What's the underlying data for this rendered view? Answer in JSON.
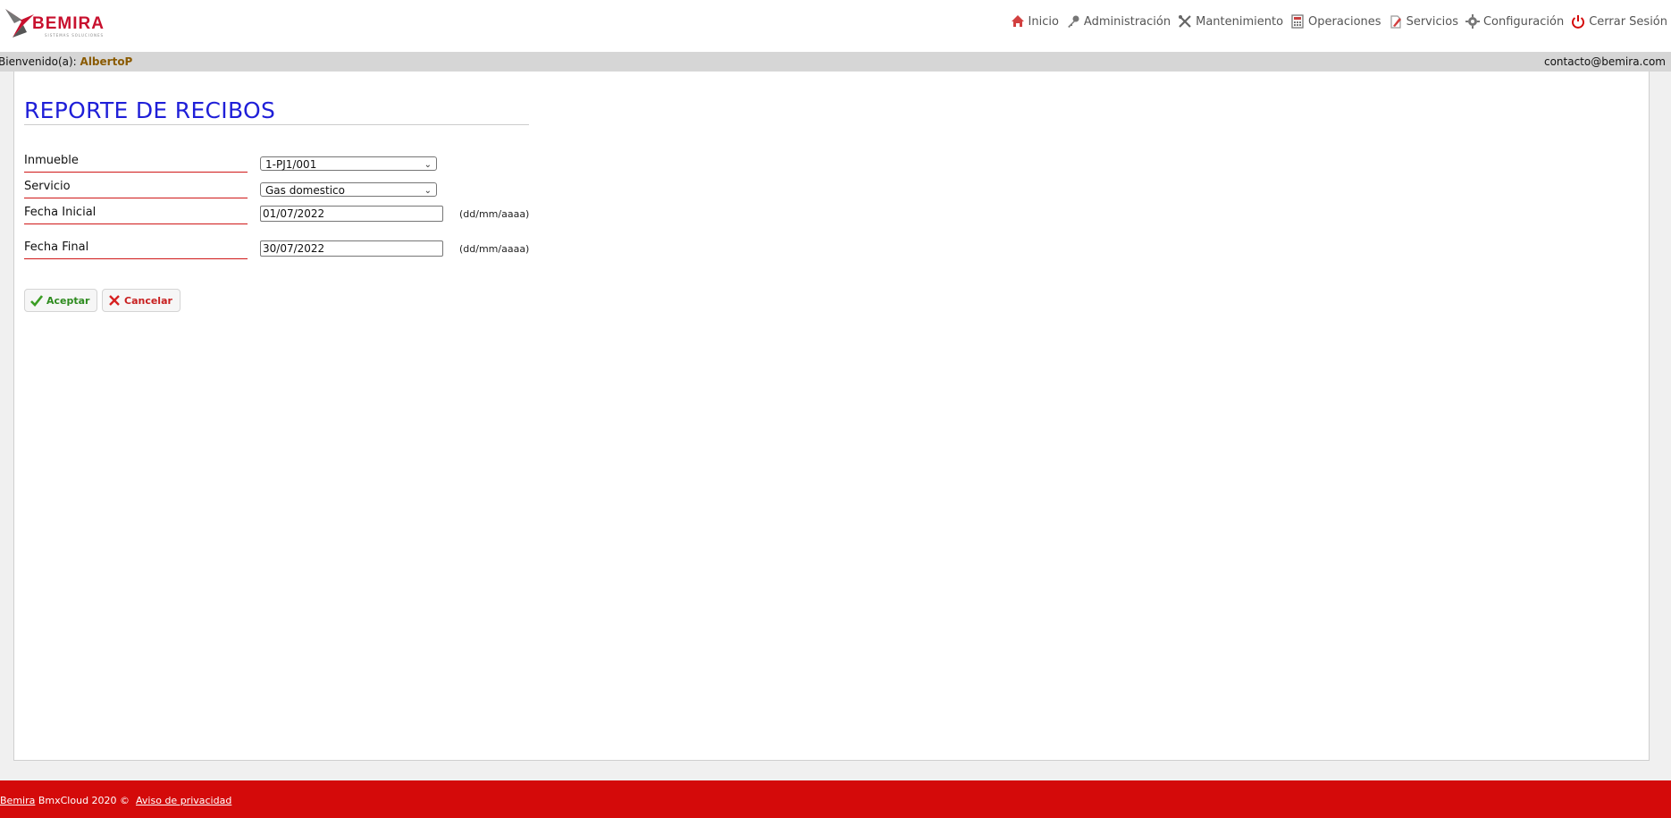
{
  "brand": {
    "name": "BEMIRA",
    "tagline": "SISTEMAS SOLUCIONES",
    "color": "#c8102e"
  },
  "nav": [
    {
      "label": "Inicio",
      "icon": "home-icon"
    },
    {
      "label": "Administración",
      "icon": "key-icon"
    },
    {
      "label": "Mantenimiento",
      "icon": "tools-icon"
    },
    {
      "label": "Operaciones",
      "icon": "calculator-icon"
    },
    {
      "label": "Servicios",
      "icon": "edit-document-icon"
    },
    {
      "label": "Configuración",
      "icon": "gear-icon"
    },
    {
      "label": "Cerrar Sesión",
      "icon": "power-icon"
    }
  ],
  "welcome": {
    "prefix": "Bienvenido(a):",
    "user": "AlbertoP",
    "contact": "contacto@bemira.com"
  },
  "page": {
    "title": "REPORTE DE RECIBOS"
  },
  "form": {
    "inmueble": {
      "label": "Inmueble",
      "value": "1-PJ1/001"
    },
    "servicio": {
      "label": "Servicio",
      "value": "Gas domestico"
    },
    "fecha_inicial": {
      "label": "Fecha Inicial",
      "value": "01/07/2022",
      "hint": "(dd/mm/aaaa)"
    },
    "fecha_final": {
      "label": "Fecha Final",
      "value": "30/07/2022",
      "hint": "(dd/mm/aaaa)"
    }
  },
  "buttons": {
    "accept": "Aceptar",
    "cancel": "Cancelar"
  },
  "footer": {
    "brand_link": "Bemira",
    "text": "BmxCloud 2020 ©",
    "privacy_link": "Aviso de privacidad"
  },
  "colors": {
    "title": "#1f1fd8",
    "footer_bg": "#d40a0a",
    "label_underline": "#d01818"
  }
}
